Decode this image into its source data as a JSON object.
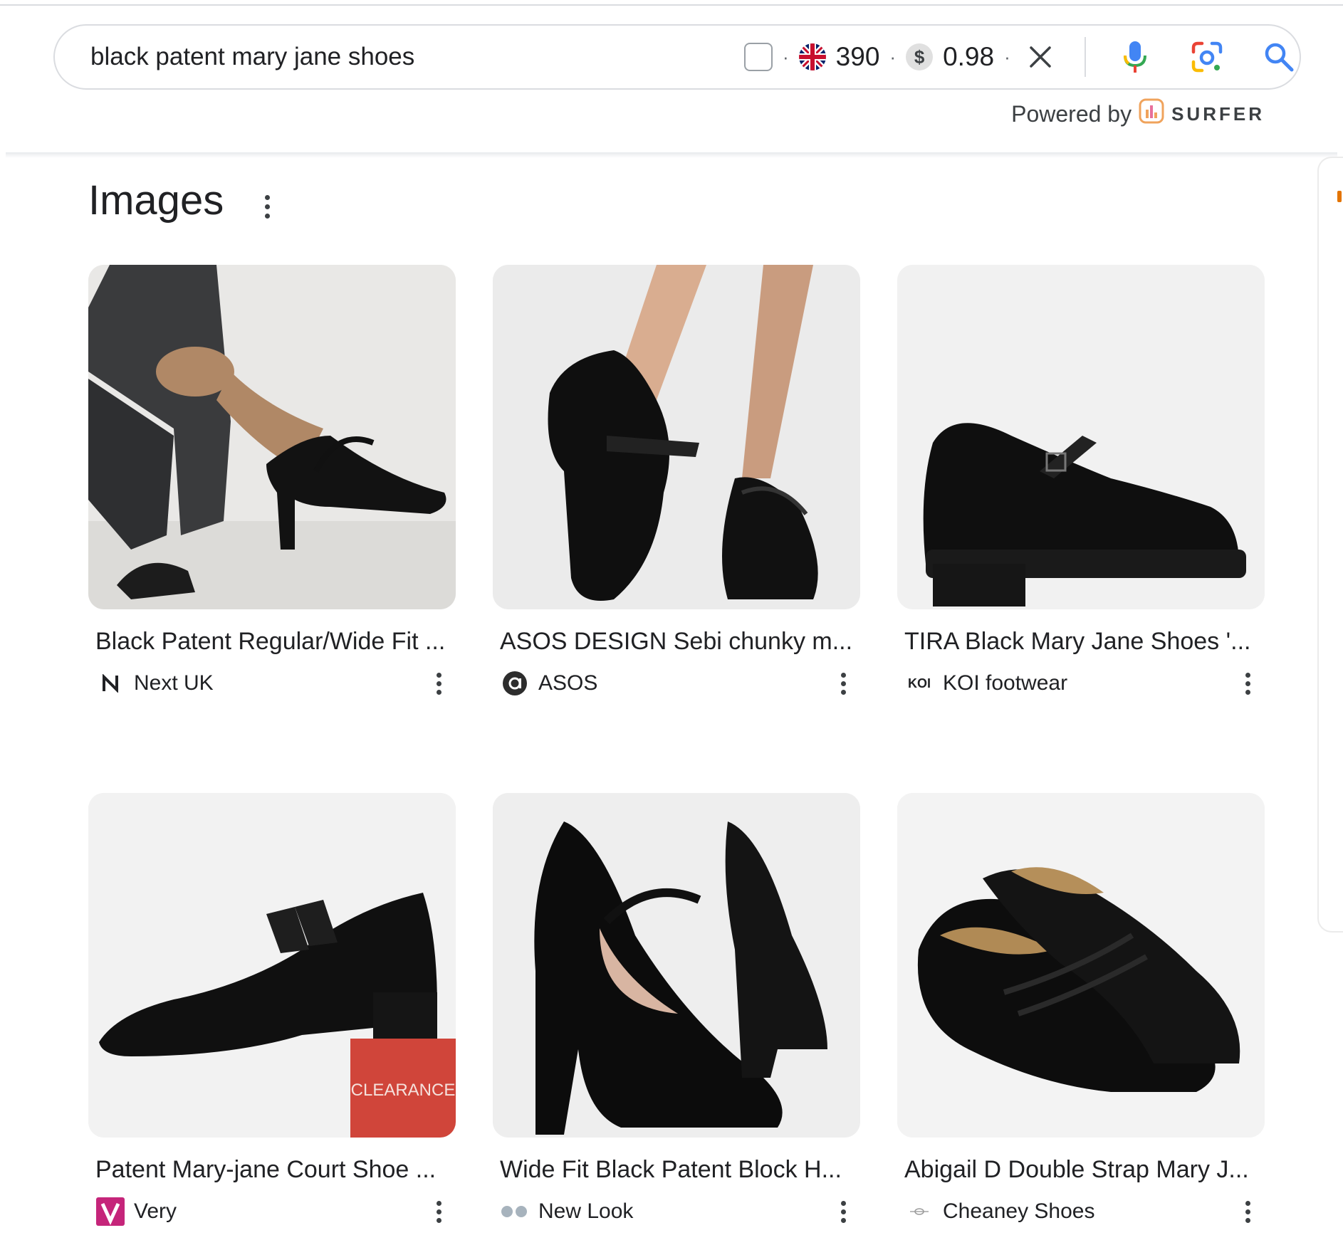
{
  "search": {
    "query": "black patent mary jane shoes",
    "volume": "390",
    "cpc": "0.98",
    "currency_symbol": "$",
    "separator": "·"
  },
  "powered_by": {
    "label": "Powered by",
    "brand": "SURFER"
  },
  "section": {
    "title": "Images"
  },
  "images": [
    {
      "title": "Black Patent Regular/Wide Fit ...",
      "source": "Next UK",
      "favicon_text": "N"
    },
    {
      "title": "ASOS DESIGN Sebi chunky m...",
      "source": "ASOS",
      "favicon_text": "a"
    },
    {
      "title": "TIRA Black Mary Jane Shoes '...",
      "source": "KOI footwear",
      "favicon_text": "KOI"
    },
    {
      "title": "Patent Mary-jane Court Shoe ...",
      "source": "Very",
      "favicon_text": "V",
      "badge": "CLEARANCE"
    },
    {
      "title": "Wide Fit Black Patent Block H...",
      "source": "New Look",
      "favicon_text": ""
    },
    {
      "title": "Abigail D Double Strap Mary J...",
      "source": "Cheaney Shoes",
      "favicon_text": ""
    }
  ],
  "colors": {
    "accent_blue": "#4285f4",
    "clearance_red": "#d0453a",
    "very_pink": "#c5257a"
  }
}
